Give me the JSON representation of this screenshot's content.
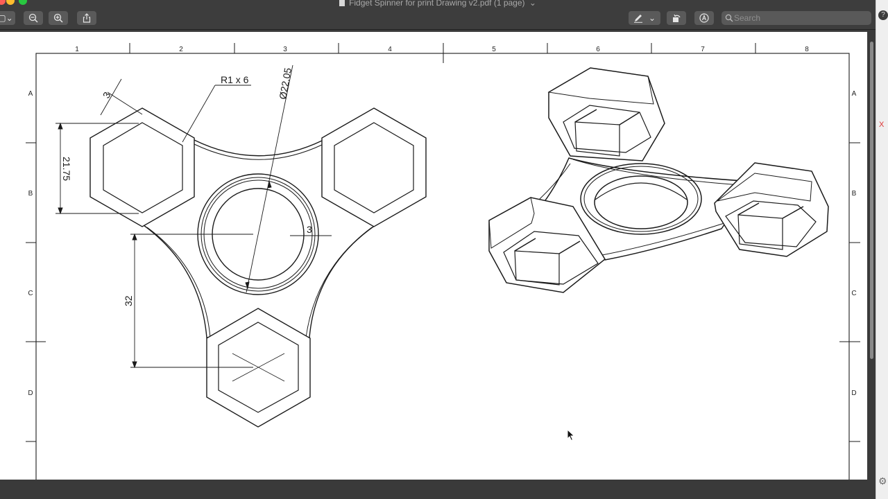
{
  "window": {
    "title": "Fidget Spinner for print Drawing v2.pdf (1 page)",
    "title_chevron": "⌄"
  },
  "toolbar": {
    "sidebar_toggle": "▢⌄",
    "zoom_out": "−",
    "zoom_in": "+",
    "markup_dropdown": "⌄",
    "search_placeholder": "Search"
  },
  "drawing": {
    "columns": [
      "1",
      "2",
      "3",
      "4",
      "5",
      "6",
      "7",
      "8"
    ],
    "rows": [
      "A",
      "B",
      "C",
      "D"
    ],
    "dimensions": {
      "radius": "R1 x 6",
      "diameter": "Ø22.05",
      "wall": "3",
      "hex_height": "21.75",
      "ring": "3",
      "offset": "32"
    }
  },
  "colors": {
    "window_bg": "#3a3a3a",
    "traffic_red": "#fe5f57",
    "traffic_yellow": "#febc2e",
    "traffic_green": "#28c840",
    "line": "#1a1a1a"
  },
  "side": {
    "mark": "X",
    "help": "?",
    "settings": "⚙"
  }
}
